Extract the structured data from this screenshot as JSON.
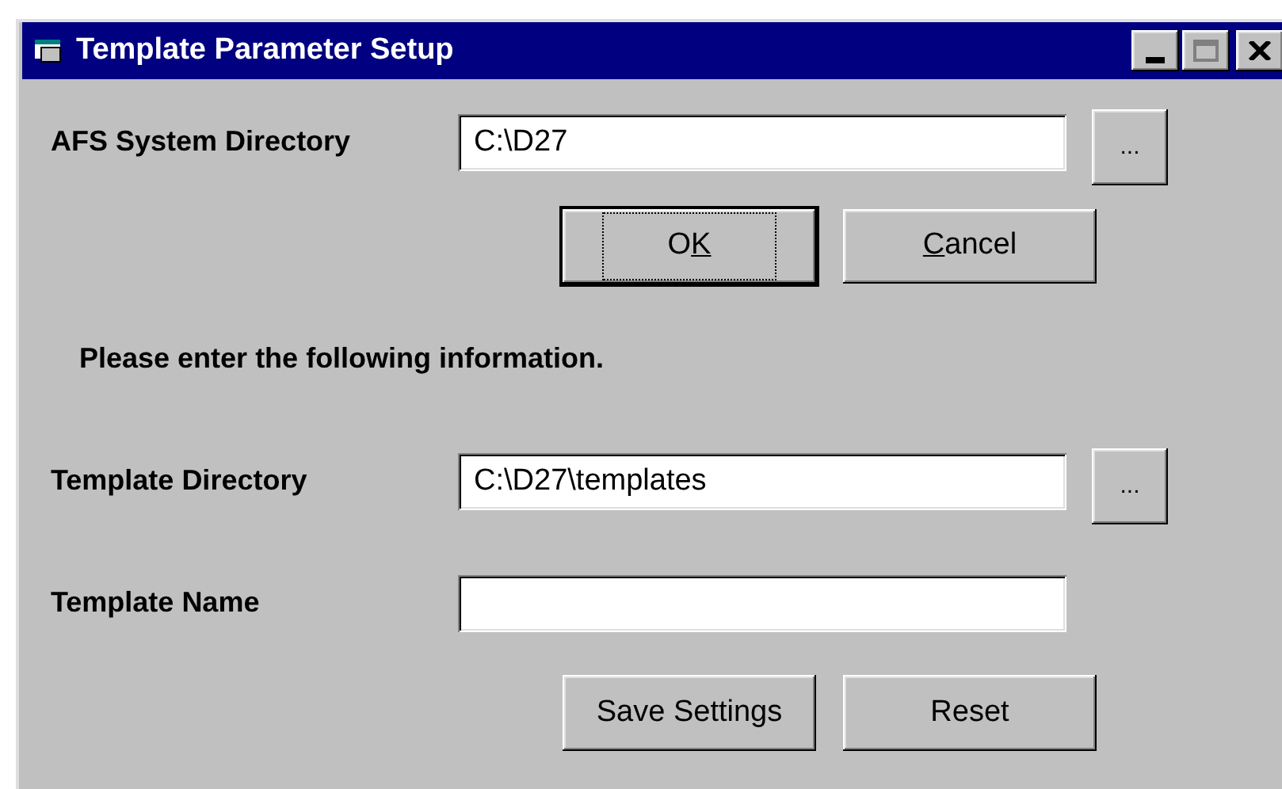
{
  "window": {
    "title": "Template Parameter Setup"
  },
  "system_directory": {
    "label": "AFS System Directory",
    "value": "C:\\D27",
    "browse": "..."
  },
  "dialog_buttons": [
    {
      "before": "O",
      "key": "K",
      "focused": true
    },
    {
      "key": "C",
      "after": "ancel",
      "focused": false
    }
  ],
  "message": "Please enter the following information.",
  "template_directory": {
    "label": "Template Directory",
    "value": "C:\\D27\\templates",
    "browse": "..."
  },
  "template_name": {
    "label": "Template Name"
  },
  "buttons": [
    {
      "label": "Save Settings",
      "focused": false
    },
    {
      "label": "Reset",
      "focused": false
    }
  ]
}
